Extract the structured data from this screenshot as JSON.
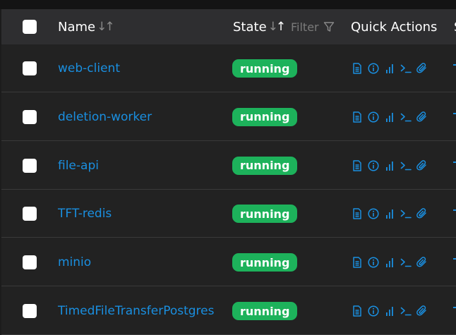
{
  "header": {
    "name_label": "Name",
    "state_label": "State",
    "filter_label": "Filter",
    "quick_actions_label": "Quick Actions",
    "next_column_label": "S"
  },
  "rows": [
    {
      "name": "web-client",
      "state": "running"
    },
    {
      "name": "deletion-worker",
      "state": "running"
    },
    {
      "name": "file-api",
      "state": "running"
    },
    {
      "name": "TFT-redis",
      "state": "running"
    },
    {
      "name": "minio",
      "state": "running"
    },
    {
      "name": "TimedFileTransferPostgres",
      "state": "running"
    }
  ],
  "quick_action_icons": [
    "logs-icon",
    "inspect-icon",
    "stats-icon",
    "console-icon",
    "attach-icon"
  ],
  "colors": {
    "accent": "#1a8fe0",
    "status_running": "#1db25b",
    "header_bg": "#2e2e30",
    "row_bg": "#222222"
  }
}
